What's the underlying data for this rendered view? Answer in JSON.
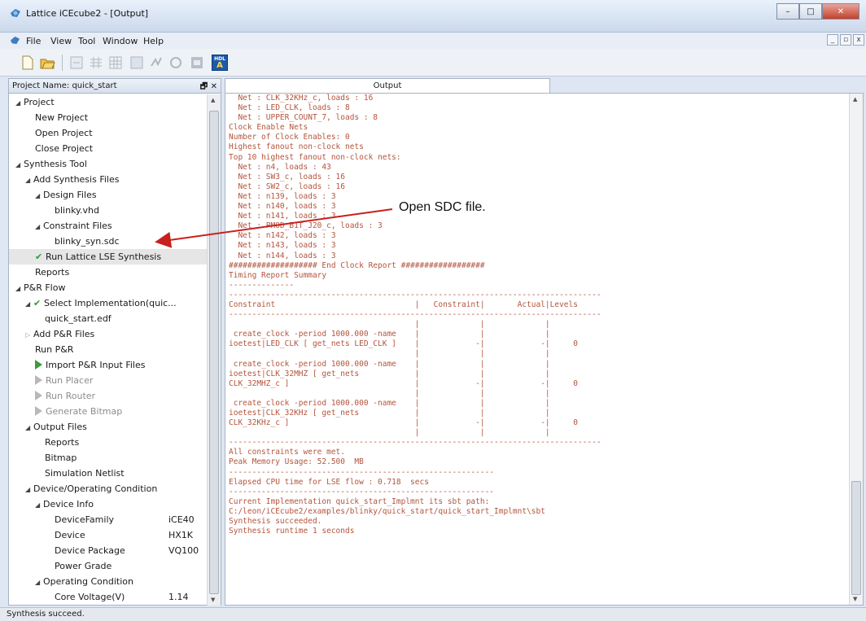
{
  "window": {
    "title": "Lattice iCEcube2 - [Output]",
    "controls": [
      "–",
      "□",
      "✕"
    ]
  },
  "menu": [
    "File",
    "View",
    "Tool",
    "Window",
    "Help"
  ],
  "mdi_controls": [
    "_",
    "▫",
    "x"
  ],
  "toolbar": {
    "hdl_label_top": "HDL",
    "hdl_label_bottom": "A"
  },
  "project_panel": {
    "header": "Project Name: quick_start",
    "controls": "🗗 ✕"
  },
  "tree": [
    {
      "label": "Project",
      "arrow": "open",
      "indent": 0
    },
    {
      "label": "New Project",
      "indent": 2
    },
    {
      "label": "Open Project",
      "indent": 2
    },
    {
      "label": "Close Project",
      "indent": 2
    },
    {
      "label": "Synthesis Tool",
      "arrow": "open",
      "indent": 0
    },
    {
      "label": "Add Synthesis Files",
      "arrow": "open",
      "indent": 1
    },
    {
      "label": "Design Files",
      "arrow": "open",
      "indent": 2
    },
    {
      "label": "blinky.vhd",
      "indent": 4
    },
    {
      "label": "Constraint Files",
      "arrow": "open",
      "indent": 2
    },
    {
      "label": "blinky_syn.sdc",
      "indent": 4
    },
    {
      "label": "Run Lattice LSE Synthesis",
      "icon": "check",
      "indent": 2,
      "selected": true
    },
    {
      "label": "Reports",
      "indent": 2
    },
    {
      "label": "P&R Flow",
      "arrow": "open",
      "indent": 0
    },
    {
      "label": "Select Implementation(quic...",
      "arrow": "open",
      "icon": "check",
      "indent": 1
    },
    {
      "label": "quick_start.edf",
      "indent": 3
    },
    {
      "label": "Add P&R Files",
      "arrow": "closed",
      "indent": 1
    },
    {
      "label": "Run P&R",
      "indent": 2
    },
    {
      "label": "Import P&R Input Files",
      "icon": "play",
      "indent": 2
    },
    {
      "label": "Run Placer",
      "icon": "play-dim",
      "indent": 2,
      "dim": true
    },
    {
      "label": "Run Router",
      "icon": "play-dim",
      "indent": 2,
      "dim": true
    },
    {
      "label": "Generate Bitmap",
      "icon": "play-dim",
      "indent": 2,
      "dim": true
    },
    {
      "label": "Output Files",
      "arrow": "open",
      "indent": 1
    },
    {
      "label": "Reports",
      "indent": 3
    },
    {
      "label": "Bitmap",
      "indent": 3
    },
    {
      "label": "Simulation Netlist",
      "indent": 3
    },
    {
      "label": "Device/Operating Condition",
      "arrow": "open",
      "indent": 1
    },
    {
      "label": "Device Info",
      "arrow": "open",
      "indent": 2
    },
    {
      "label": "DeviceFamily",
      "value": "iCE40",
      "indent": 4
    },
    {
      "label": "Device",
      "value": "HX1K",
      "indent": 4
    },
    {
      "label": "Device Package",
      "value": "VQ100",
      "indent": 4
    },
    {
      "label": "Power Grade",
      "indent": 4
    },
    {
      "label": "Operating Condition",
      "arrow": "open",
      "indent": 2
    },
    {
      "label": "Core Voltage(V)",
      "value": "1.14",
      "indent": 4
    }
  ],
  "output_tab": "Output",
  "log_lines": [
    "  Net : CLK_32KHz_c, loads : 16",
    "  Net : LED_CLK, loads : 8",
    "  Net : UPPER_COUNT_7, loads : 8",
    "Clock Enable Nets",
    "Number of Clock Enables: 0",
    "Highest fanout non-clock nets",
    "Top 10 highest fanout non-clock nets:",
    "  Net : n4, loads : 43",
    "  Net : SW3_c, loads : 16",
    "  Net : SW2_c, loads : 16",
    "  Net : n139, loads : 3",
    "  Net : n140, loads : 3",
    "  Net : n141, loads : 3",
    "  Net : PMOD_B1T_J20_c, loads : 3",
    "  Net : n142, loads : 3",
    "  Net : n143, loads : 3",
    "  Net : n144, loads : 3",
    "################### End Clock Report ##################",
    "Timing Report Summary",
    "--------------",
    "--------------------------------------------------------------------------------",
    "Constraint                              |   Constraint|       Actual|Levels",
    "--------------------------------------------------------------------------------",
    "                                        |             |             |",
    " create_clock -period 1000.000 -name    |             |             |",
    "ioetest|LED_CLK [ get_nets LED_CLK ]    |            -|            -|     0",
    "                                        |             |             |",
    " create_clock -period 1000.000 -name    |             |             |",
    "ioetest|CLK_32MHZ [ get_nets            |             |             |",
    "CLK_32MHZ_c ]                           |            -|            -|     0",
    "                                        |             |             |",
    " create_clock -period 1000.000 -name    |             |             |",
    "ioetest|CLK_32KHz [ get_nets            |             |             |",
    "CLK_32KHz_c ]                           |            -|            -|     0",
    "                                        |             |             |",
    "--------------------------------------------------------------------------------",
    "All constraints were met.",
    "Peak Memory Usage: 52.500  MB",
    "---------------------------------------------------------",
    "Elapsed CPU time for LSE flow : 0.718  secs",
    "---------------------------------------------------------",
    "Current Implementation quick_start_Implmnt its sbt path:",
    "C:/leon/iCEcube2/examples/blinky/quick_start/quick_start_Implmnt\\sbt",
    "Synthesis succeeded.",
    "Synthesis runtime 1 seconds",
    ""
  ],
  "annotation": {
    "text": "Open SDC file.",
    "arrow_color": "#c8201c"
  },
  "status": "Synthesis succeed.",
  "colors": {
    "log_text": "#b4543c",
    "check": "#2e9a2e",
    "play": "#3a9b3a"
  }
}
